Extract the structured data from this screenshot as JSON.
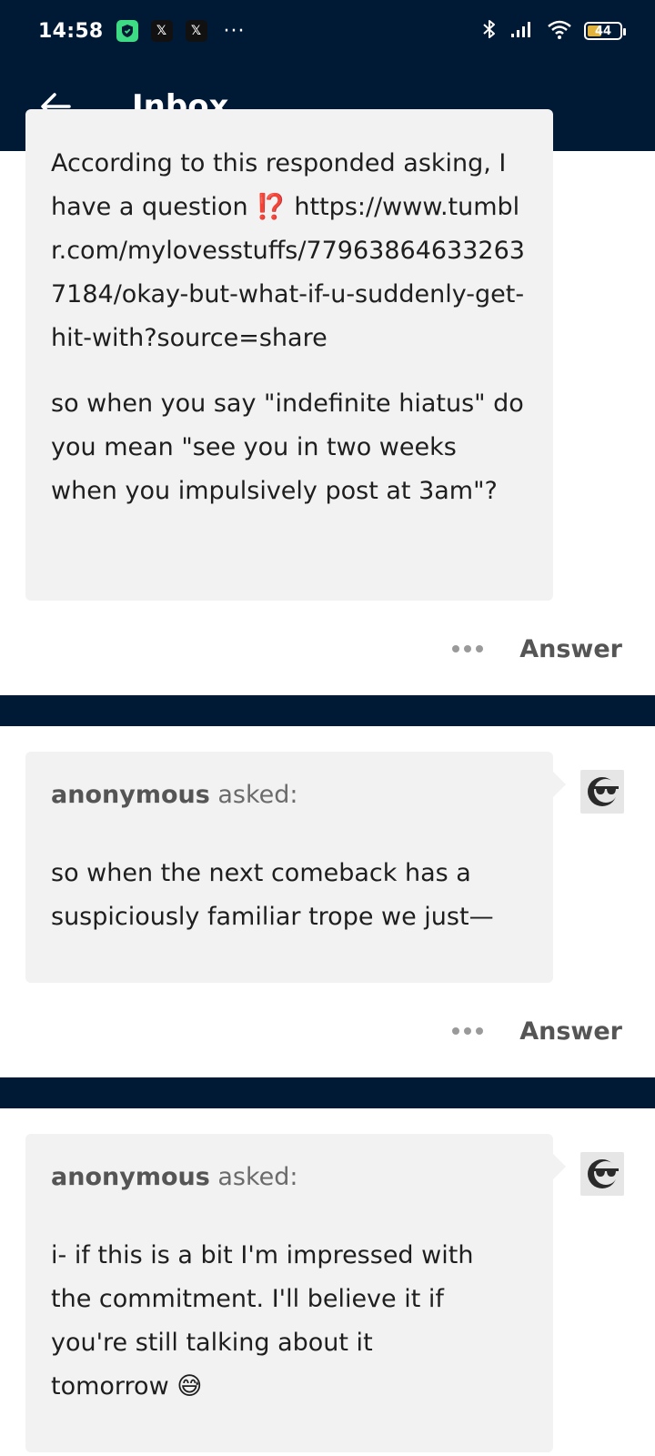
{
  "status_bar": {
    "time": "14:58",
    "notification_icons": [
      "shield-app-icon",
      "x-icon",
      "x-icon"
    ],
    "more": "···",
    "battery": "44",
    "accent": "#001935"
  },
  "header": {
    "title": "Inbox"
  },
  "messages": [
    {
      "asker_name": "",
      "asked_label": "",
      "paragraphs": [
        "According to this responded asking, I have a question ⁉️ https://www.tumblr.com/mylovesstuffs/779638646332637184/okay-but-what-if-u-suddenly-get-hit-with?source=share",
        "so when you say \"indefinite hiatus\" do you mean \"see you in two weeks when you impulsively post at 3am\"?"
      ],
      "answer_label": "Answer"
    },
    {
      "asker_name": "anonymous",
      "asked_label": "asked:",
      "paragraphs": [
        "so when the next comeback has a suspiciously familiar trope we just—"
      ],
      "answer_label": "Answer"
    },
    {
      "asker_name": "anonymous",
      "asked_label": "asked:",
      "paragraphs": [
        "i- if this is a bit I'm impressed with the commitment. I'll believe it if you're still talking about it tomorrow 😅"
      ],
      "answer_label": "Answer"
    }
  ],
  "avatar_icon": "anonymous-sunglasses-icon"
}
